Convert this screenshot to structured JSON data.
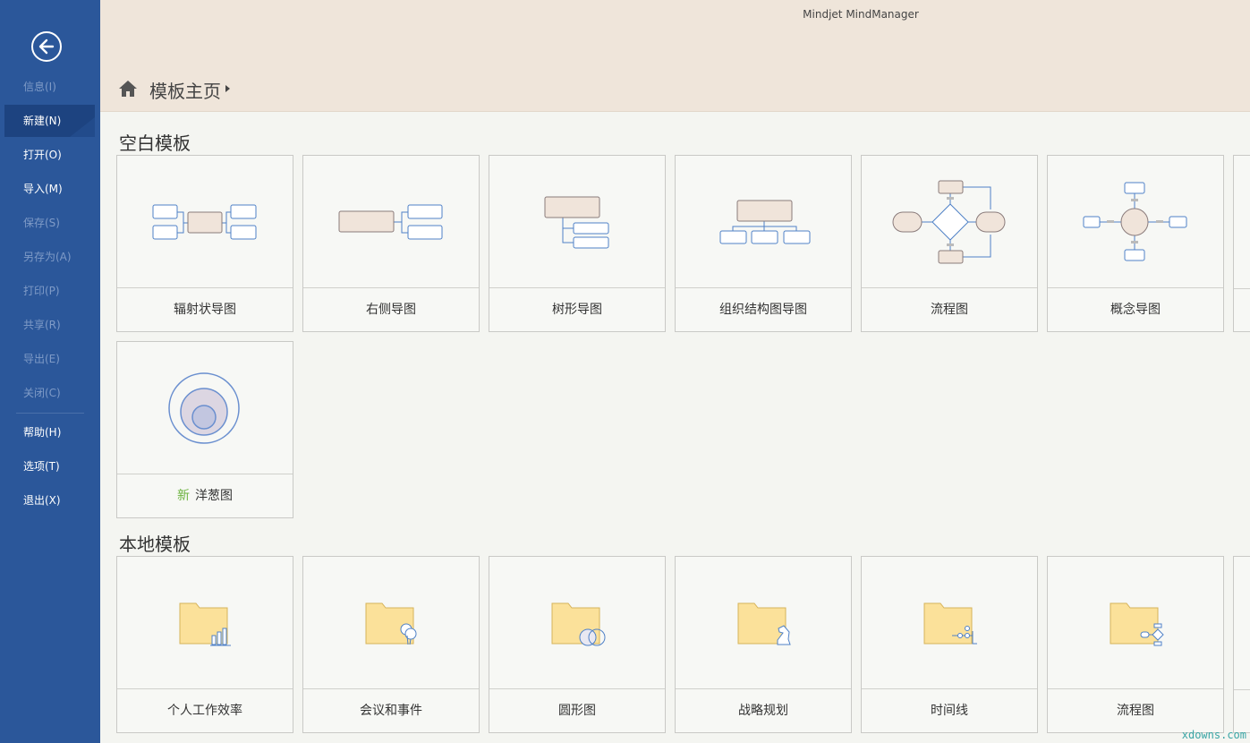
{
  "app": {
    "title": "Mindjet MindManager"
  },
  "breadcrumb": {
    "home_icon": "home-icon",
    "label": "模板主页"
  },
  "sidebar": {
    "back_icon": "back-arrow-icon",
    "items": [
      {
        "label": "信息(I)",
        "enabled": false
      },
      {
        "label": "新建(N)",
        "enabled": true,
        "active": true
      },
      {
        "label": "打开(O)",
        "enabled": true
      },
      {
        "label": "导入(M)",
        "enabled": true
      },
      {
        "label": "保存(S)",
        "enabled": false
      },
      {
        "label": "另存为(A)",
        "enabled": false
      },
      {
        "label": "打印(P)",
        "enabled": false
      },
      {
        "label": "共享(R)",
        "enabled": false
      },
      {
        "label": "导出(E)",
        "enabled": false
      },
      {
        "label": "关闭(C)",
        "enabled": false
      },
      {
        "label": "帮助(H)",
        "enabled": true
      },
      {
        "label": "选项(T)",
        "enabled": true
      },
      {
        "label": "退出(X)",
        "enabled": true
      }
    ]
  },
  "sections": {
    "blank": {
      "title": "空白模板",
      "templates": [
        {
          "label": "辐射状导图",
          "icon": "radial-map-icon"
        },
        {
          "label": "右侧导图",
          "icon": "right-map-icon"
        },
        {
          "label": "树形导图",
          "icon": "tree-map-icon"
        },
        {
          "label": "组织结构图导图",
          "icon": "org-chart-icon"
        },
        {
          "label": "流程图",
          "icon": "flowchart-icon"
        },
        {
          "label": "概念导图",
          "icon": "concept-map-icon"
        },
        {
          "badge": "新",
          "label": "洋葱图",
          "icon": "onion-diagram-icon"
        }
      ]
    },
    "local": {
      "title": "本地模板",
      "templates": [
        {
          "label": "个人工作效率",
          "icon": "folder-chart-icon"
        },
        {
          "label": "会议和事件",
          "icon": "folder-balloon-icon"
        },
        {
          "label": "圆形图",
          "icon": "folder-circles-icon"
        },
        {
          "label": "战略规划",
          "icon": "folder-chess-icon"
        },
        {
          "label": "时间线",
          "icon": "folder-timeline-icon"
        },
        {
          "label": "流程图",
          "icon": "folder-flowchart-icon"
        }
      ]
    }
  },
  "watermark": "xdowns.com",
  "colors": {
    "sidebar": "#2b579a",
    "header": "#efe5da",
    "accent_new": "#6cb33f",
    "shape_fill": "#f0e4da",
    "shape_stroke": "#4f81c7"
  }
}
